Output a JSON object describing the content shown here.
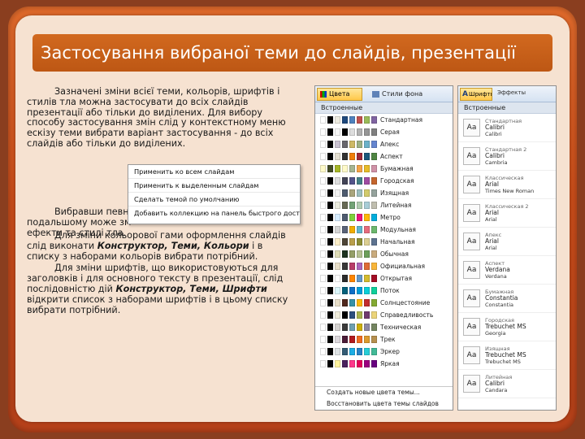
{
  "slide": {
    "title": "Застосування вибраної теми до слайдів, презентації",
    "para1": "Зазначені зміни всієї теми, кольорів, шрифтів і стилів тла можна застосувати до всіх слайдів презентації або тільки до виділених. Для вибору способу застосування змін слід у контекстному меню ескізу теми вибрати варіант застосування  -  до всіх слайдів або тільки до виділених.",
    "para2": "Вибравши певну подальшому може зм ефекти та стилі тла.",
    "para3_before": "Для зміни кольорової гами оформлення слайдів слід виконати ",
    "para3_bold1": "Конструктор,  Теми,  Кольори",
    "para3_after": "  і в списку з наборами кольорів  вибрати потрібний.",
    "para4_before": "Для зміни шрифтів, що використовуються для заголовків і для основного тексту в презентації, слід послідовністю дій ",
    "para4_bold": "Конструктор, Теми, Шрифти",
    "para4_after": " відкрити список з наборами шрифтів і в цьому списку вибрати потрібний."
  },
  "context_menu": {
    "items": [
      "Применить ко всем слайдам",
      "Применить к выделенным слайдам",
      "Сделать темой по умолчанию",
      "Добавить коллекцию на панель быстрого доступа"
    ]
  },
  "colors_gallery": {
    "button_label": "Цвета",
    "bg_button_label": "Стили фона",
    "section_label": "Встроенные",
    "themes": [
      {
        "name": "Стандартная",
        "colors": [
          "#ffffff",
          "#000000",
          "#eeece1",
          "#1f497d",
          "#4f81bd",
          "#c0504d",
          "#9bbb59",
          "#8064a2"
        ]
      },
      {
        "name": "Серая",
        "colors": [
          "#ffffff",
          "#000000",
          "#f8f8f8",
          "#000000",
          "#dddddd",
          "#b2b2b2",
          "#969696",
          "#808080"
        ]
      },
      {
        "name": "Апекс",
        "colors": [
          "#ffffff",
          "#000000",
          "#c9c2d1",
          "#69676d",
          "#ceb966",
          "#9cb084",
          "#6bb1c9",
          "#6585cf"
        ]
      },
      {
        "name": "Аспект",
        "colors": [
          "#ffffff",
          "#000000",
          "#e3ded1",
          "#323232",
          "#f07f09",
          "#9f2936",
          "#1b587c",
          "#4e8542"
        ]
      },
      {
        "name": "Бумажная",
        "colors": [
          "#fefac9",
          "#444d26",
          "#a6b727",
          "#fefac9",
          "#a5b592",
          "#f3a447",
          "#e7bc29",
          "#d092a7"
        ]
      },
      {
        "name": "Городская",
        "colors": [
          "#ffffff",
          "#000000",
          "#dedede",
          "#424456",
          "#53548a",
          "#438086",
          "#a04da3",
          "#c4652d"
        ]
      },
      {
        "name": "Изящная",
        "colors": [
          "#ffffff",
          "#000000",
          "#f2f2f2",
          "#4e5b6f",
          "#a9a57c",
          "#9cbebd",
          "#d2cb6c",
          "#95a39d"
        ]
      },
      {
        "name": "Литейная",
        "colors": [
          "#ffffff",
          "#000000",
          "#eaebde",
          "#676a55",
          "#72a376",
          "#b0ccb0",
          "#a8cdd7",
          "#c0beaf"
        ]
      },
      {
        "name": "Метро",
        "colors": [
          "#ffffff",
          "#000000",
          "#d6ecff",
          "#4e5b6f",
          "#7fd13b",
          "#ea157a",
          "#feb80a",
          "#00addc"
        ]
      },
      {
        "name": "Модульная",
        "colors": [
          "#ffffff",
          "#000000",
          "#d4d4d4",
          "#5a6378",
          "#f0ad00",
          "#60b5cc",
          "#e66c7d",
          "#6bb76d"
        ]
      },
      {
        "name": "Начальная",
        "colors": [
          "#ffffff",
          "#000000",
          "#fbeec9",
          "#4d4436",
          "#b89e4a",
          "#8b8d34",
          "#dbce91",
          "#5d7390"
        ]
      },
      {
        "name": "Обычная",
        "colors": [
          "#ffffff",
          "#000000",
          "#dfdcb7",
          "#1d331f",
          "#959f68",
          "#b6c193",
          "#6d9f5c",
          "#c9ab7e"
        ]
      },
      {
        "name": "Официальная",
        "colors": [
          "#ffffff",
          "#000000",
          "#e7dec9",
          "#383838",
          "#b83d68",
          "#ac66bb",
          "#de6c36",
          "#f9b639"
        ]
      },
      {
        "name": "Открытая",
        "colors": [
          "#ffffff",
          "#000000",
          "#ffffff",
          "#2c2c2c",
          "#ff8600",
          "#6599c7",
          "#d4bc2f",
          "#a30c24"
        ]
      },
      {
        "name": "Поток",
        "colors": [
          "#ffffff",
          "#000000",
          "#dbf5f9",
          "#04617b",
          "#0f6fc6",
          "#009dd9",
          "#0bd0d9",
          "#10cf9b"
        ]
      },
      {
        "name": "Солнцестояние",
        "colors": [
          "#ffffff",
          "#000000",
          "#e7dec9",
          "#4f271c",
          "#3891a7",
          "#feb80a",
          "#c32d2e",
          "#84aa33"
        ]
      },
      {
        "name": "Справедливость",
        "colors": [
          "#ffffff",
          "#000000",
          "#f0eddc",
          "#000000",
          "#2c4e7e",
          "#a9b34d",
          "#6f3a6f",
          "#ebd479"
        ]
      },
      {
        "name": "Техническая",
        "colors": [
          "#ffffff",
          "#000000",
          "#d4d2d0",
          "#3b3b3b",
          "#6ea0b0",
          "#ccaf0a",
          "#8d89a4",
          "#748560"
        ]
      },
      {
        "name": "Трек",
        "colors": [
          "#ffffff",
          "#000000",
          "#dcd8dc",
          "#4b1c37",
          "#b11a1e",
          "#f06c22",
          "#dc9c30",
          "#b6904e"
        ]
      },
      {
        "name": "Эркер",
        "colors": [
          "#ffffff",
          "#000000",
          "#dfe3e5",
          "#335b74",
          "#1cade4",
          "#2683c6",
          "#27ced7",
          "#42ba97"
        ]
      },
      {
        "name": "Яркая",
        "colors": [
          "#ffffff",
          "#000000",
          "#fff39d",
          "#4a215e",
          "#ff388c",
          "#e40059",
          "#9c007f",
          "#68007f"
        ]
      }
    ],
    "footer_items": [
      "Создать новые цвета темы...",
      "Восстановить цвета темы слайдов"
    ]
  },
  "fonts_gallery": {
    "button_label": "Шрифты",
    "right_label": "Эффекты",
    "section_label": "Встроенные",
    "sample": "Аа",
    "fonts": [
      {
        "kind": "Стандартная",
        "heading": "Calibri",
        "body": "Calibri"
      },
      {
        "kind": "Стандартная 2",
        "heading": "Calibri",
        "body": "Cambria"
      },
      {
        "kind": "Классическая",
        "heading": "Arial",
        "body": "Times New Roman"
      },
      {
        "kind": "Классическая 2",
        "heading": "Arial",
        "body": "Arial"
      },
      {
        "kind": "Апекс",
        "heading": "Arial",
        "body": "Arial"
      },
      {
        "kind": "Аспект",
        "heading": "Verdana",
        "body": "Verdana"
      },
      {
        "kind": "Бумажная",
        "heading": "Constantia",
        "body": "Constantia"
      },
      {
        "kind": "Городская",
        "heading": "Trebuchet MS",
        "body": "Georgia"
      },
      {
        "kind": "Изящная",
        "heading": "Trebuchet MS",
        "body": "Trebuchet MS"
      },
      {
        "kind": "Литейная",
        "heading": "Calibri",
        "body": "Candara"
      }
    ]
  }
}
